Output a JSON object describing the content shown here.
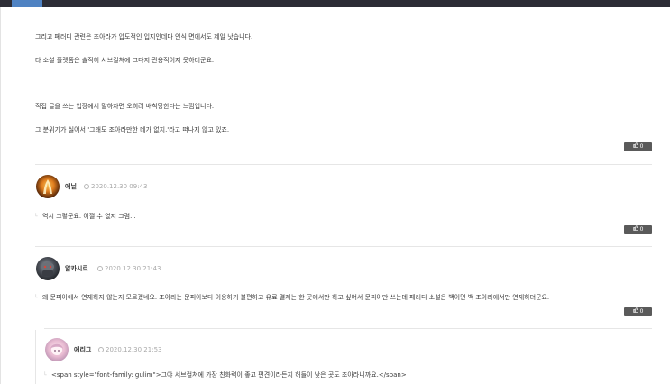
{
  "post": {
    "lines": [
      "그리고 페러디 관련은 조아라가 압도적인 입지인데다 인식 면에서도 제일 낫습니다.",
      "타 소설 플랫폼은 솔직히 서브컬쳐에 그다지 관용적이지 못하더군요.",
      "직접 글을 쓰는 입장에서 말하자면 오히려 배척당한다는 느낌입니다.",
      "그 분위기가 싫어서 '그래도 조아라만한 데가 없지.'라고 떠나지 않고 있죠."
    ],
    "like_count": "0"
  },
  "comments": [
    {
      "author": "에닐",
      "date": "2020.12.30 09:43",
      "text": "역시 그렇군요. 어쩔 수 없지 그럼...",
      "like_count": "0"
    },
    {
      "author": "알카시르",
      "date": "2020.12.30 21:43",
      "text": "왜 문피아에서 연재하지 않는지 모르겠네요. 조아라는 문피아보다 이용하기 불편하고 유료 결제는 한 곳에서만 하고 싶어서 문피아만 쓰는데 패러디 소설은 백이면 백 조아라에서만 연재하더군요.",
      "like_count": "0"
    },
    {
      "author": "에리그",
      "date": "2020.12.30 21:53",
      "text": "<span style=\"font-family: gulim\">그야 서브컬쳐에 가장 친화력이 좋고 편견이라든지 허들이 낮은 곳도 조아라니까요.</span>"
    }
  ],
  "icons": {
    "like": "thumbs-up-icon",
    "clock": "clock-icon",
    "reply": "reply-arrow-icon"
  },
  "colors": {
    "topbar": "#2c2c35",
    "accent": "#4f82c2",
    "like_button": "#5a5a5a"
  }
}
